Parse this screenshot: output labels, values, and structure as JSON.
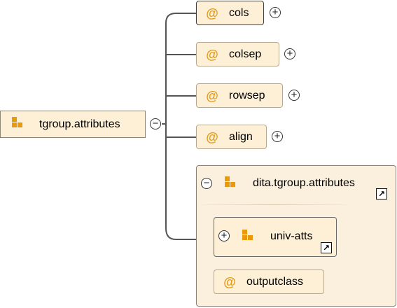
{
  "diagram": {
    "root": {
      "label": "tgroup.attributes",
      "icon": "attribute-group-icon",
      "toggle": "−"
    },
    "attributes": [
      {
        "label": "cols",
        "symbol": "@",
        "toggle": "+"
      },
      {
        "label": "colsep",
        "symbol": "@",
        "toggle": "+"
      },
      {
        "label": "rowsep",
        "symbol": "@",
        "toggle": "+"
      },
      {
        "label": "align",
        "symbol": "@",
        "toggle": "+"
      }
    ],
    "group": {
      "label": "dita.tgroup.attributes",
      "icon": "attribute-group-icon",
      "toggle": "−",
      "reference_icon": "↗",
      "children": [
        {
          "label": "univ-atts",
          "icon": "attribute-group-icon",
          "toggle": "+",
          "reference_icon": "↗"
        },
        {
          "label": "outputclass",
          "symbol": "@"
        }
      ]
    },
    "colors": {
      "node_fill": "#fdf0d6",
      "icon_orange": "#e99a0c",
      "connector": "#555555"
    }
  }
}
